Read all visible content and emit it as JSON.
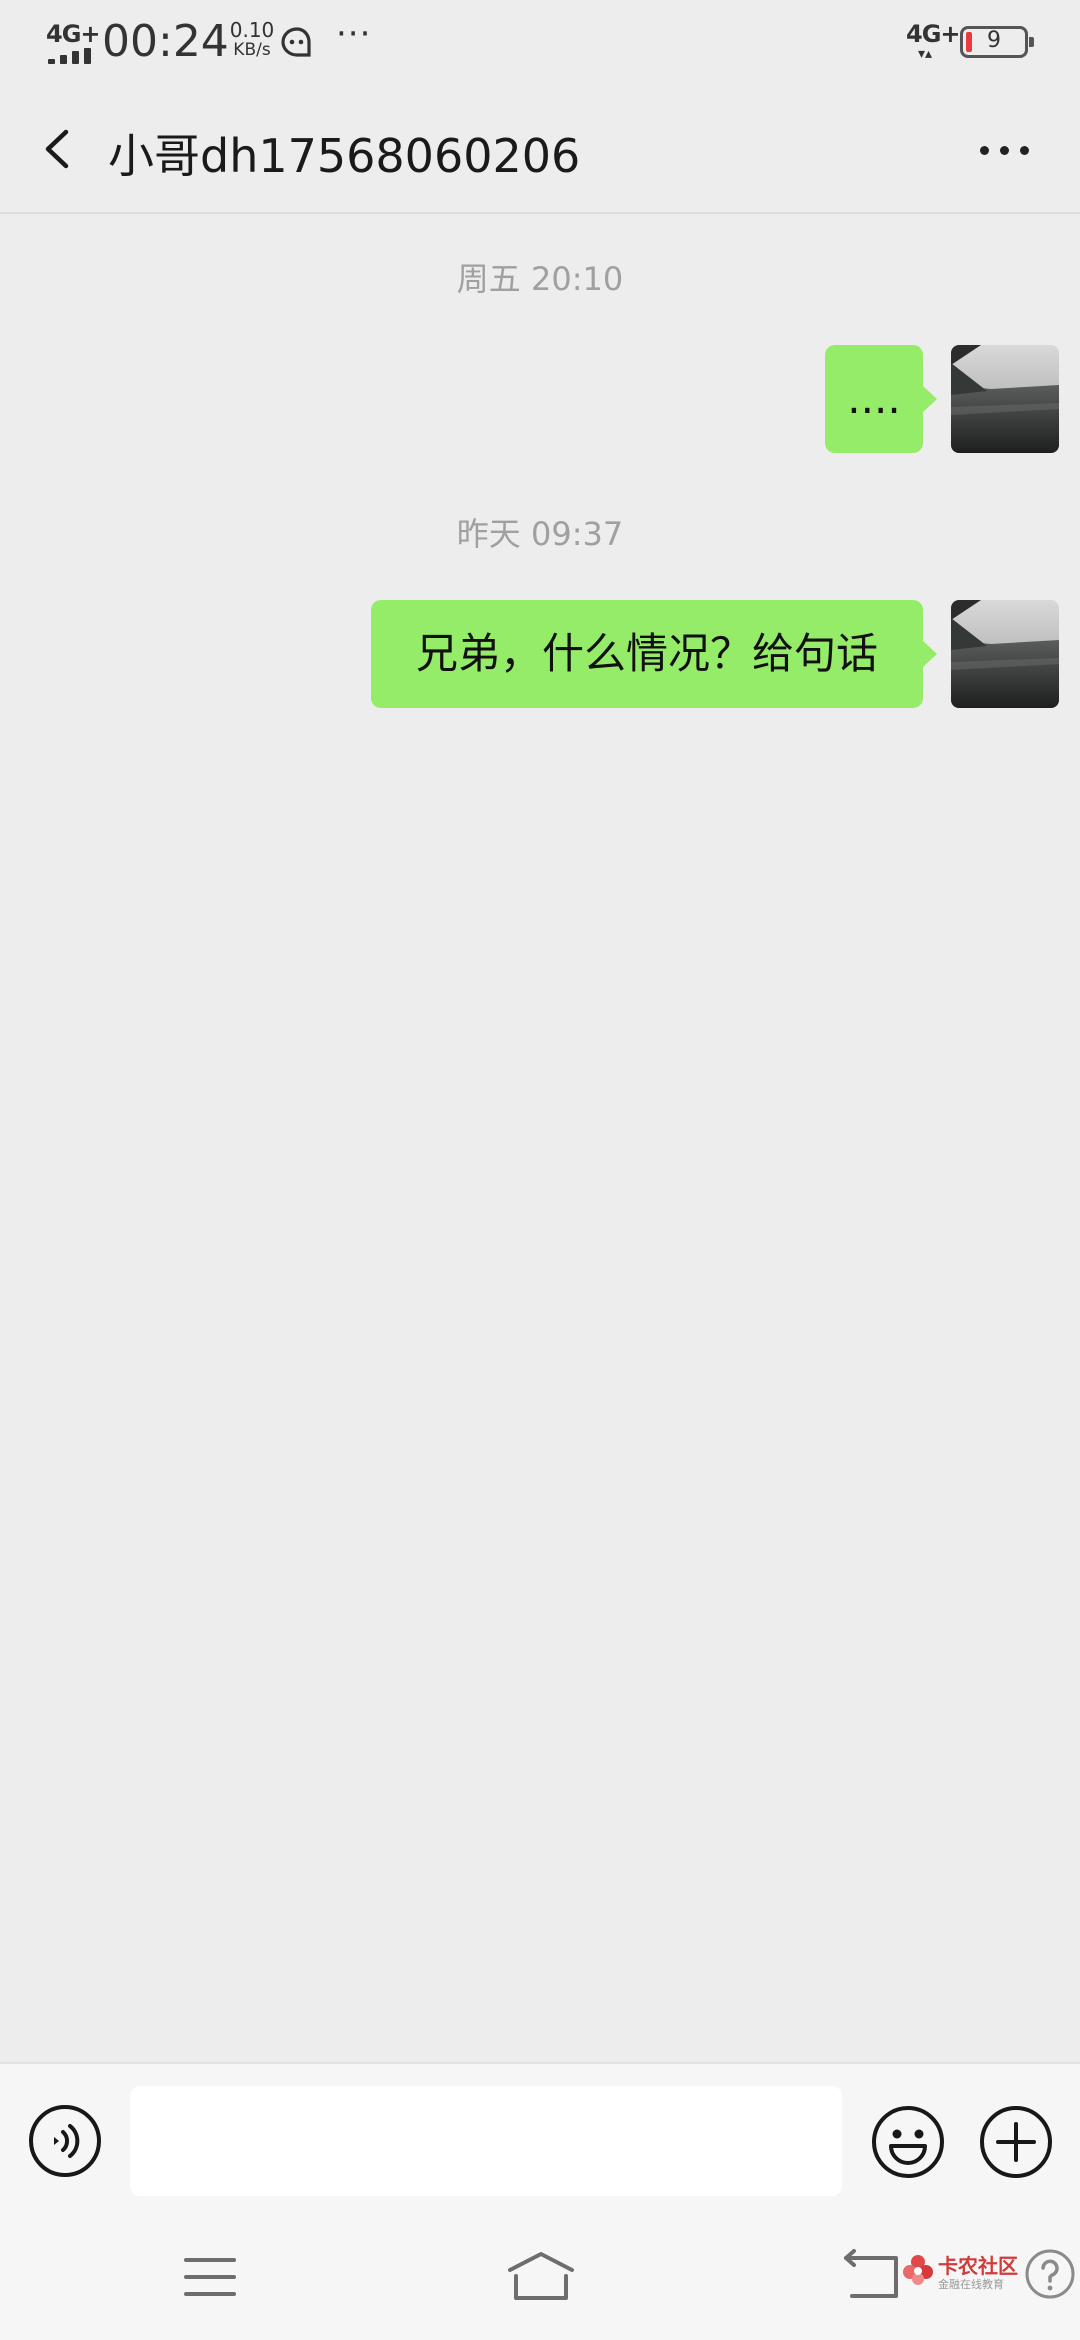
{
  "status_bar": {
    "network_left": "4G+",
    "time": "00:24",
    "speed_value": "0.10",
    "speed_unit": "KB/s",
    "more": "···",
    "network_right": "4G+",
    "battery_level": "9"
  },
  "header": {
    "title": "小哥dh17568060206"
  },
  "messages": [
    {
      "timestamp": "周五 20:10",
      "text": "....",
      "sender": "me"
    },
    {
      "timestamp": "昨天 09:37",
      "text": "兄弟，什么情况？给句话",
      "sender": "me"
    }
  ],
  "input": {
    "value": ""
  },
  "watermark": {
    "main": "卡农社区",
    "sub": "金融在线教育"
  },
  "colors": {
    "background": "#ededed",
    "bubble": "#95ec69",
    "timestamp": "#a0a0a0"
  }
}
